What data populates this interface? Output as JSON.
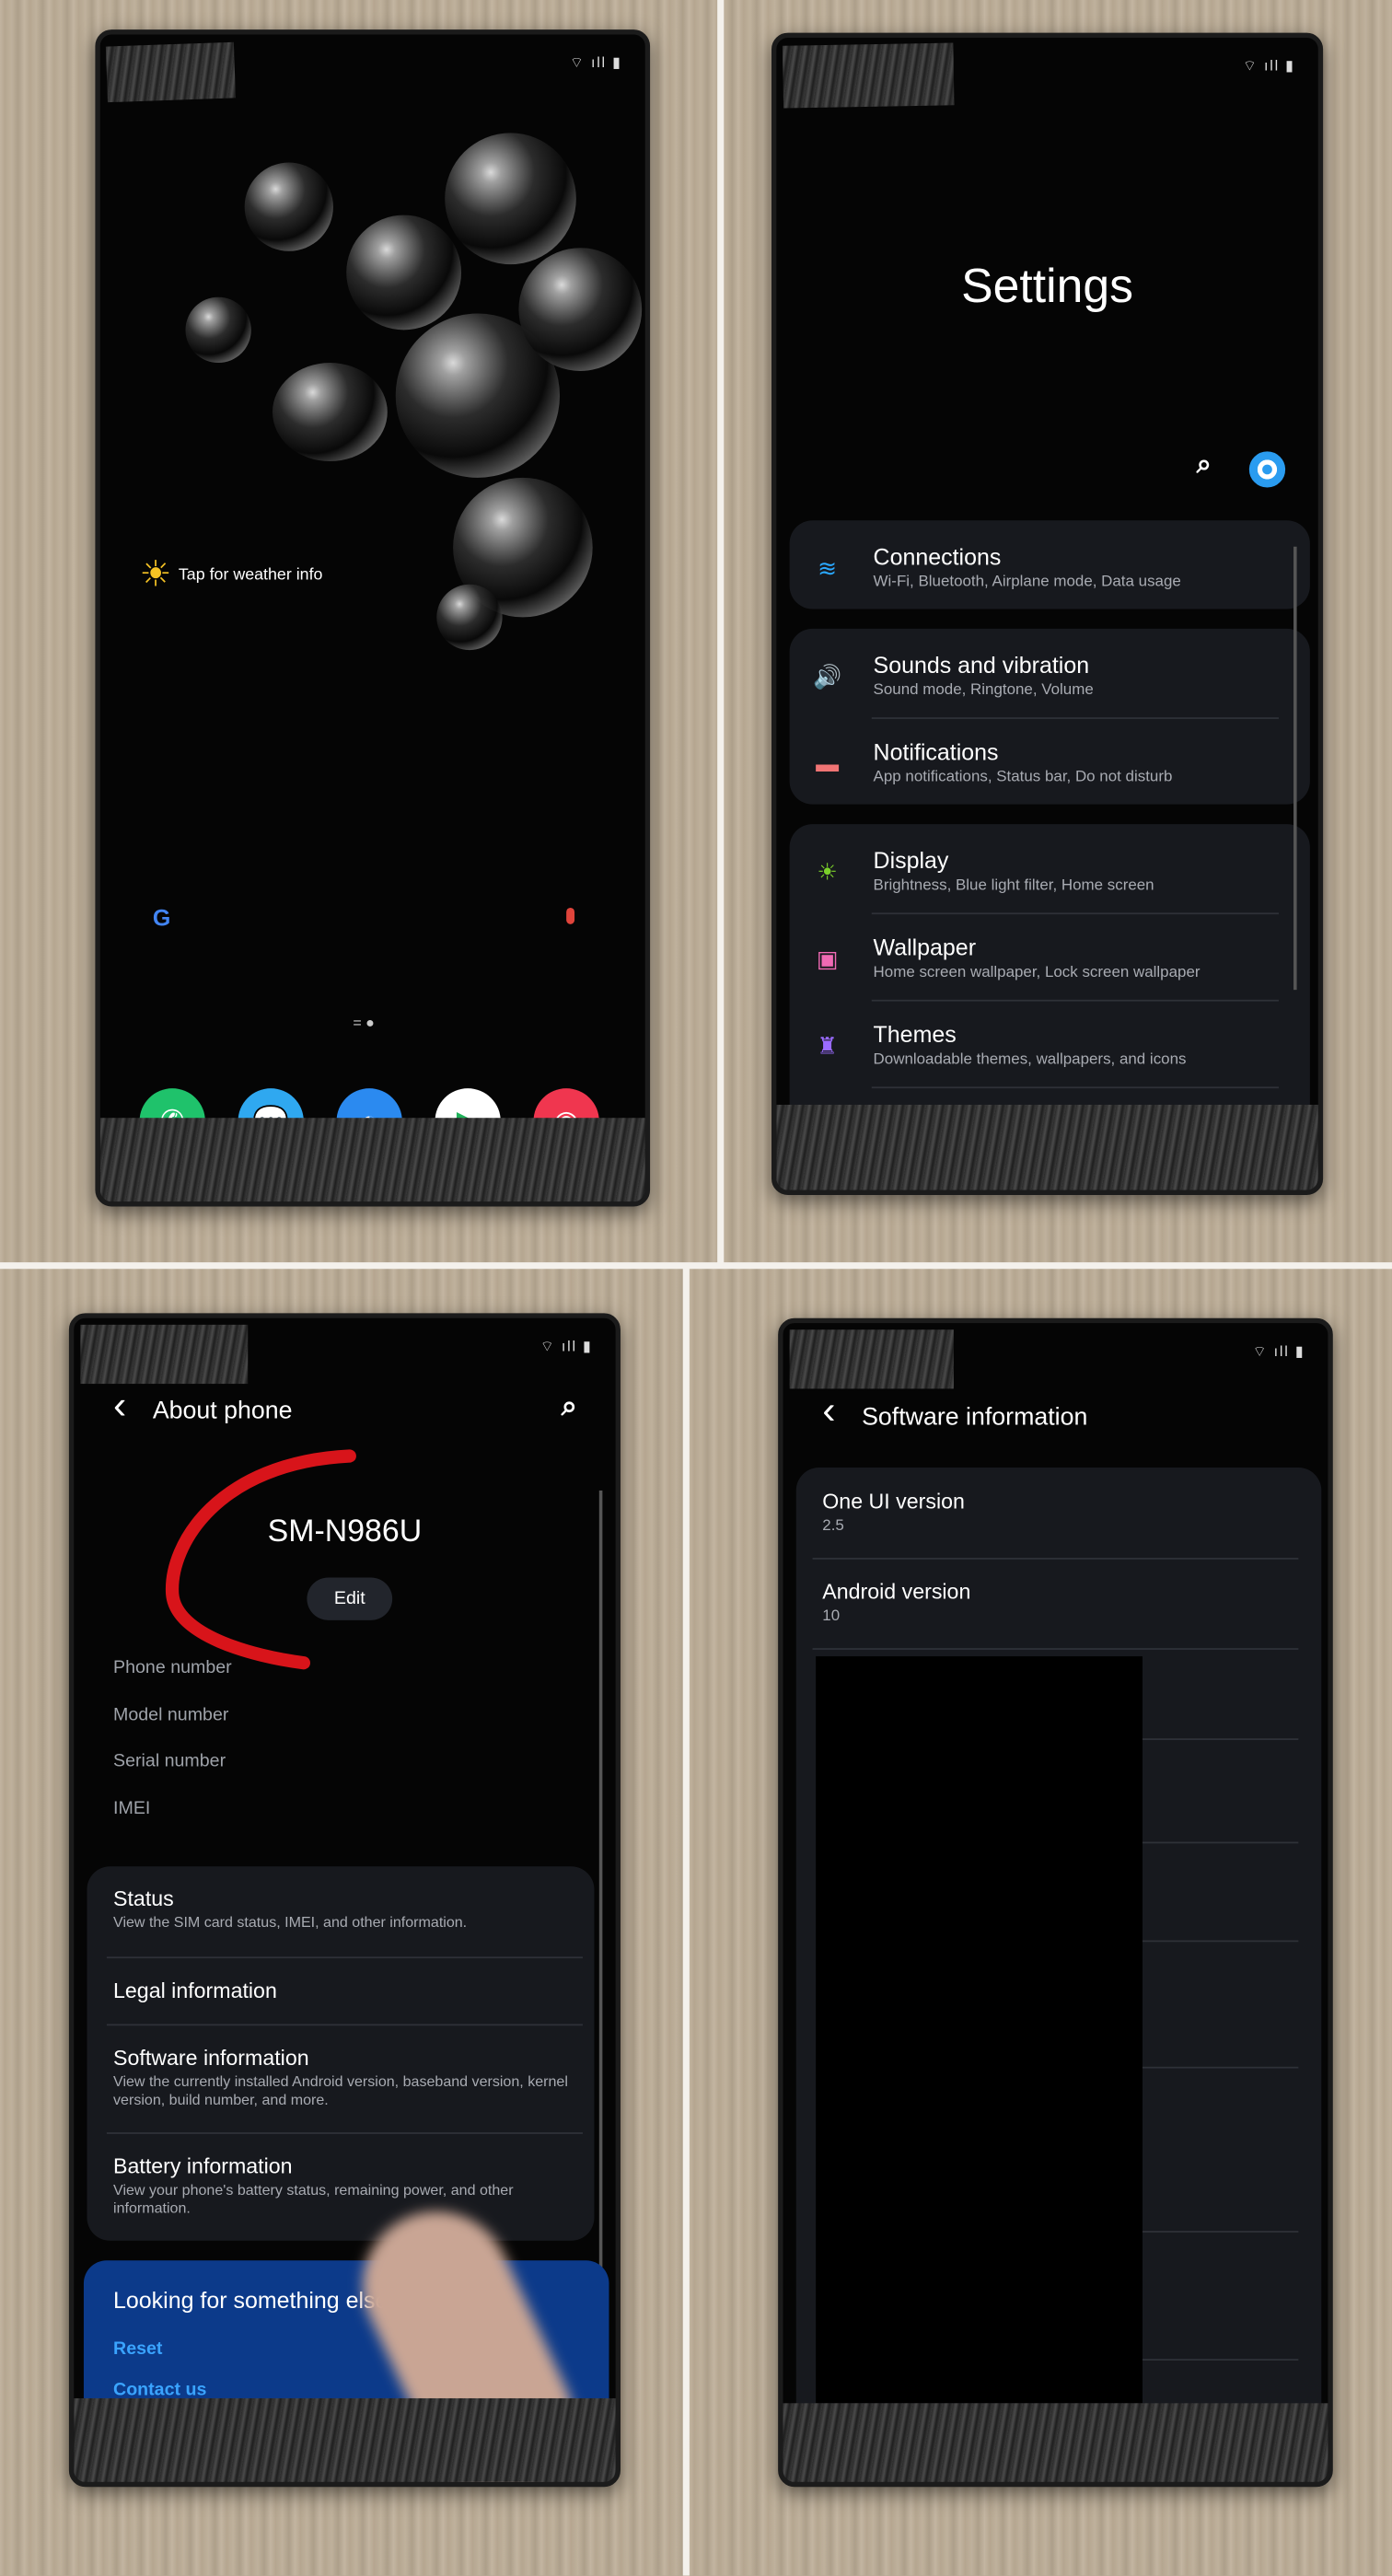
{
  "home": {
    "status_icons": "⌔ ıll ▮",
    "weather_label": "Tap for weather info",
    "google_icon": "G",
    "mic_icon": "🎤",
    "dock": [
      {
        "name": "phone",
        "color": "#1fc26b",
        "glyph": "✆"
      },
      {
        "name": "messages",
        "color": "#2fa8f0",
        "glyph": "💬"
      },
      {
        "name": "internet",
        "color": "#2b8af0",
        "glyph": "◐"
      },
      {
        "name": "play-store",
        "color": "#ffffff",
        "glyph": "▶"
      },
      {
        "name": "camera",
        "color": "#f0364f",
        "glyph": "◉"
      }
    ]
  },
  "settings": {
    "status_icons": "⌔ ıll ▮",
    "title": "Settings",
    "search_icon": "⌕",
    "account_icon": "●",
    "items": [
      {
        "title": "Connections",
        "subtitle": "Wi-Fi, Bluetooth, Airplane mode, Data usage",
        "icon": "wifi",
        "color": "#2aa8ff",
        "glyph": "≋"
      },
      {
        "title": "Sounds and vibration",
        "subtitle": "Sound mode, Ringtone, Volume",
        "icon": "speaker",
        "color": "#3f86ff",
        "glyph": "🔊"
      },
      {
        "title": "Notifications",
        "subtitle": "App notifications, Status bar, Do not disturb",
        "icon": "notification",
        "color": "#f07474",
        "glyph": "▬"
      },
      {
        "title": "Display",
        "subtitle": "Brightness, Blue light filter, Home screen",
        "icon": "sun",
        "color": "#7bd12a",
        "glyph": "☀"
      },
      {
        "title": "Wallpaper",
        "subtitle": "Home screen wallpaper, Lock screen wallpaper",
        "icon": "image",
        "color": "#f06ab4",
        "glyph": "▣"
      },
      {
        "title": "Themes",
        "subtitle": "Downloadable themes, wallpapers, and icons",
        "icon": "brush",
        "color": "#9a6bff",
        "glyph": "♜"
      }
    ]
  },
  "about": {
    "status_icons": "⌔ ıll ▮",
    "title": "About phone",
    "back_icon": "‹",
    "search_icon": "⌕",
    "model": "SM-N986U",
    "edit_label": "Edit",
    "fields": [
      "Phone number",
      "Model number",
      "Serial number",
      "IMEI"
    ],
    "items": [
      {
        "title": "Status",
        "subtitle": "View the SIM card status, IMEI, and other information."
      },
      {
        "title": "Legal information",
        "subtitle": ""
      },
      {
        "title": "Software information",
        "subtitle": "View the currently installed Android version, baseband version, kernel version, build number, and more."
      },
      {
        "title": "Battery information",
        "subtitle": "View your phone's battery status, remaining power, and other information."
      }
    ],
    "looking": {
      "title": "Looking for something else?",
      "links": [
        "Reset",
        "Contact us"
      ]
    },
    "annotation_color": "#d8141a"
  },
  "software": {
    "status_icons": "⌔ ıll ▮",
    "title": "Software information",
    "back_icon": "‹",
    "items": [
      {
        "title": "One UI version",
        "value": "2.5"
      },
      {
        "title": "Android version",
        "value": "10"
      }
    ]
  }
}
